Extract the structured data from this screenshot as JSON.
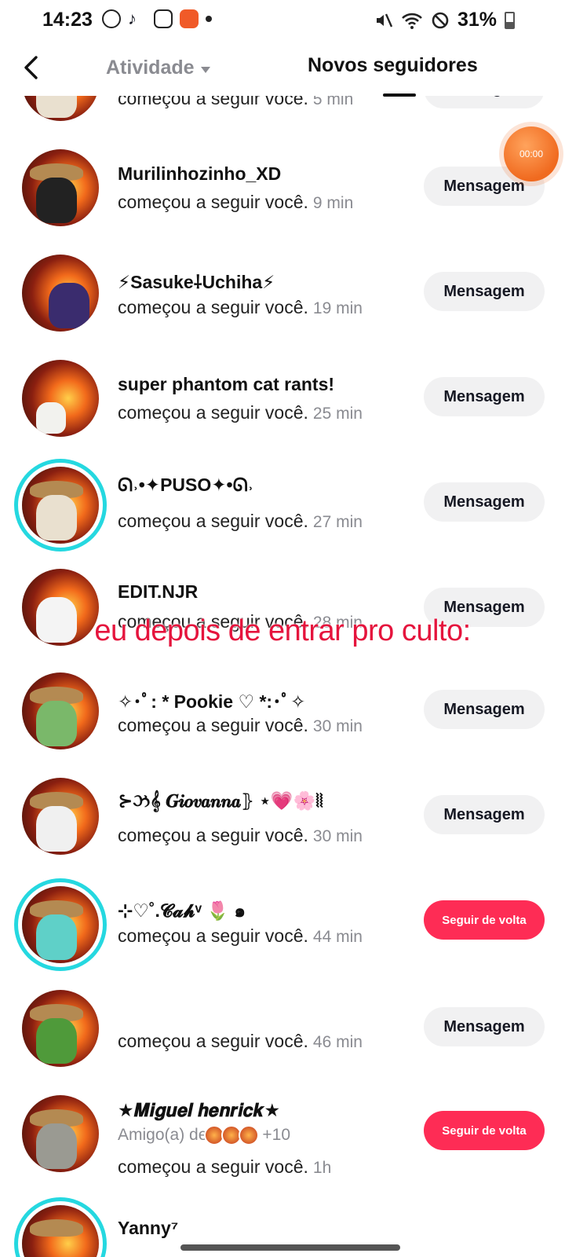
{
  "status_bar": {
    "time": "14:23",
    "battery": "31%",
    "left_icons": [
      "whatsapp-icon",
      "tiktok-icon",
      "instagram-icon",
      "app-icon",
      "dot-icon"
    ],
    "right_icons": [
      "mute-icon",
      "wifi-icon",
      "do-not-disturb-icon",
      "battery-icon"
    ]
  },
  "header": {
    "activity_tab": "Atividade",
    "followers_tab": "Novos seguidores"
  },
  "accent_colors": {
    "follow_button": "#fe2c55",
    "story_ring": "#25d8e0",
    "caption": "#e5143d"
  },
  "timer": "00:00",
  "caption": "eu depois de entrar pro culto:",
  "followers": [
    {
      "name": "",
      "action": "começou a seguir você.",
      "time": "5 min",
      "button": "Mensagem"
    },
    {
      "name": "Murilinhozinho_XD",
      "action": "começou a seguir você.",
      "time": "9 min",
      "button": "Mensagem"
    },
    {
      "name": "⚡Sasuke⸸Uchiha⚡",
      "action": "começou a seguir você.",
      "time": "19 min",
      "button": "Mensagem"
    },
    {
      "name": "super phantom cat rants!",
      "action": "começou a seguir você.",
      "time": "25 min",
      "button": "Mensagem"
    },
    {
      "name": "ᘏ˒•✦PUSO✦•ᘏ˒",
      "action": "começou a seguir você.",
      "time": "27 min",
      "button": "Mensagem"
    },
    {
      "name": "EDIT.NJR",
      "action": "começou a seguir você.",
      "time": "28 min",
      "button": "Mensagem"
    },
    {
      "name": "✧･ﾟ: * Pookie ♡ *:･ﾟ✧",
      "action": "começou a seguir você.",
      "time": "30 min",
      "button": "Mensagem"
    },
    {
      "name": "⊱ઝ𝄞 𝑮𝒊𝒐𝒗𝒂𝒏𝒏𝒂⦄ ⋆💗🌸⦚⦚",
      "action": "começou a seguir você.",
      "time": "30 min",
      "button": "Mensagem"
    },
    {
      "name": "⊹♡˚.𝓒𝓪𝓱ᵛ 🌷 ๑",
      "action": "começou a seguir você.",
      "time": "44 min",
      "button": "Seguir de volta"
    },
    {
      "name": "",
      "action": "começou a seguir você.",
      "time": "46 min",
      "button": "Mensagem"
    },
    {
      "name": "★𝑴𝒊𝒈𝒖𝒆𝒍 𝒉𝒆𝒏𝒓𝒊𝒄𝒌★",
      "friend_of": "Amigo(a) de",
      "friend_more": "+10",
      "action": "começou a seguir você.",
      "time": "1h",
      "button": "Seguir de volta"
    },
    {
      "name": "Yanny⁷",
      "action": "",
      "time": "",
      "button": ""
    }
  ]
}
